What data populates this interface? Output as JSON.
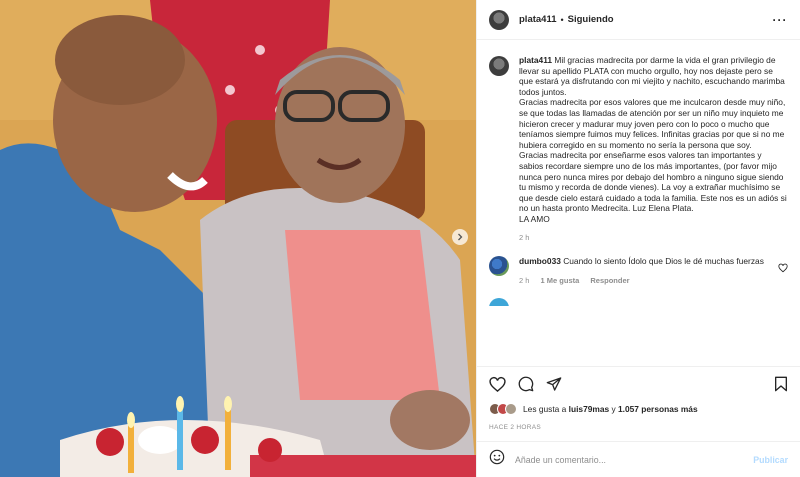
{
  "post": {
    "username": "plata411",
    "follow_status": "Siguiendo",
    "more_icon": "more-horizontal-icon"
  },
  "caption": {
    "username": "plata411",
    "text": "Mil gracias madrecita por darme la vida el gran privilegio de llevar su apellido PLATA con mucho orgullo, hoy nos dejaste pero se que estará ya disfrutando con mi viejito y nachito, escuchando marimba todos juntos.\nGracias madrecita por esos valores que me inculcaron desde muy niño, se que todas las llamadas de atención por ser un niño muy inquieto me hicieron crecer y madurar muy joven pero con lo poco o mucho que teníamos siempre fuimos muy felices. Infinitas gracias por que si no me hubiera corregido en su momento no sería la persona que soy.\nGracias madrecita por enseñarme esos valores tan importantes y sabios recordare siempre uno de los más importantes, (por favor mijo nunca pero nunca mires por debajo del hombro a ninguno sigue siendo tu mismo y recorda de donde vienes). La voy a extrañar muchísimo se que desde cielo estará cuidado a toda la familia. Este nos es un adiós si no un hasta pronto Medrecita. Luz Elena Plata.\nLA AMO",
    "time": "2 h"
  },
  "comments": [
    {
      "username": "dumbo033",
      "text": "Cuando lo siento Ídolo que Dios le dé muchas fuerzas",
      "time": "2 h",
      "likes": "1 Me gusta",
      "reply": "Responder"
    }
  ],
  "cut_comment": "_ _ _ _ _ _ _ _    _ _ _ _ _ _ _ _ _",
  "likes": {
    "prefix": "Les gusta a",
    "user": "luis79mas",
    "middle": "y",
    "others": "1.057 personas más"
  },
  "time_ago": "HACE 2 HORAS",
  "add_comment": {
    "placeholder": "Añade un comentario...",
    "publish": "Publicar"
  },
  "icons": {
    "like": "heart-icon",
    "comment": "comment-icon",
    "share": "send-icon",
    "save": "bookmark-icon",
    "emoji": "emoji-icon"
  }
}
